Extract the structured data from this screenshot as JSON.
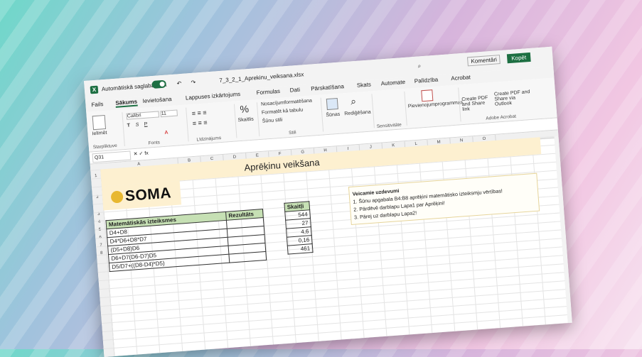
{
  "titlebar": {
    "autosave": "Automātiskā saglabāšana",
    "filename": "7_3_2_1_Aprekinu_veiksana.xlsx",
    "comments": "Komentāri",
    "copy": "Kopēt"
  },
  "tabs": [
    "Fails",
    "Sākums",
    "Ievietošana",
    "Lappuses izkārtojums",
    "Formulas",
    "Dati",
    "Pārskatīšana",
    "Skats",
    "Automate",
    "Palīdzība",
    "Acrobat"
  ],
  "ribbon": {
    "paste": "Ielīmēt",
    "clipboard": "Starpliktuve",
    "font_name": "Calibri",
    "font_size": "11",
    "font_group": "Fonts",
    "alignment": "Līdzinājums",
    "percent": "Skaitlis",
    "cond_format": "Nosacījumformatēšana",
    "table_format": "Formatēt kā tabulu",
    "cell_styles": "Šūnu stili",
    "styles_group": "Stili",
    "cells": "Šūnas",
    "editing": "Rediģēšana",
    "sensitivity": "Sensitivitāte",
    "addins": "Pievienojumprogrammas",
    "pdf1": "Create PDF and Share link",
    "pdf2": "Create PDF and Share via Outlook",
    "acrobat": "Adobe Acrobat"
  },
  "namebox": "Q31",
  "columns": [
    "A",
    "B",
    "C",
    "D",
    "E",
    "F",
    "G",
    "H",
    "I",
    "J",
    "K",
    "L",
    "M",
    "N",
    "O"
  ],
  "rows": [
    "1",
    "2",
    "3",
    "4",
    "5",
    "6",
    "7",
    "8"
  ],
  "sheet": {
    "title": "Aprēķinu veikšana",
    "logo": "SOMA",
    "expr_header": "Matemātiskās izteiksmes",
    "result_header": "Rezultāts",
    "expressions": [
      "D4+D8",
      "D4*D6+D8*D7",
      "(D5+D8)D6",
      "D6+D7(D6-D7)D5",
      "D5/D7+((D8-D4)*D5)"
    ],
    "numbers_header": "Skaitļi",
    "numbers": [
      "544",
      "27",
      "4,6",
      "0,16",
      "461"
    ],
    "tasks_title": "Veicamie uzdevumi",
    "tasks": [
      "1. Šūnu apgabala B4:B8 aprēķini matemātisko izteiksmju vērtības!",
      "2. Pārdēvē darblapu Lapa1 par Aprēķini!",
      "3. Pārej uz darblapu Lapa2!"
    ]
  }
}
